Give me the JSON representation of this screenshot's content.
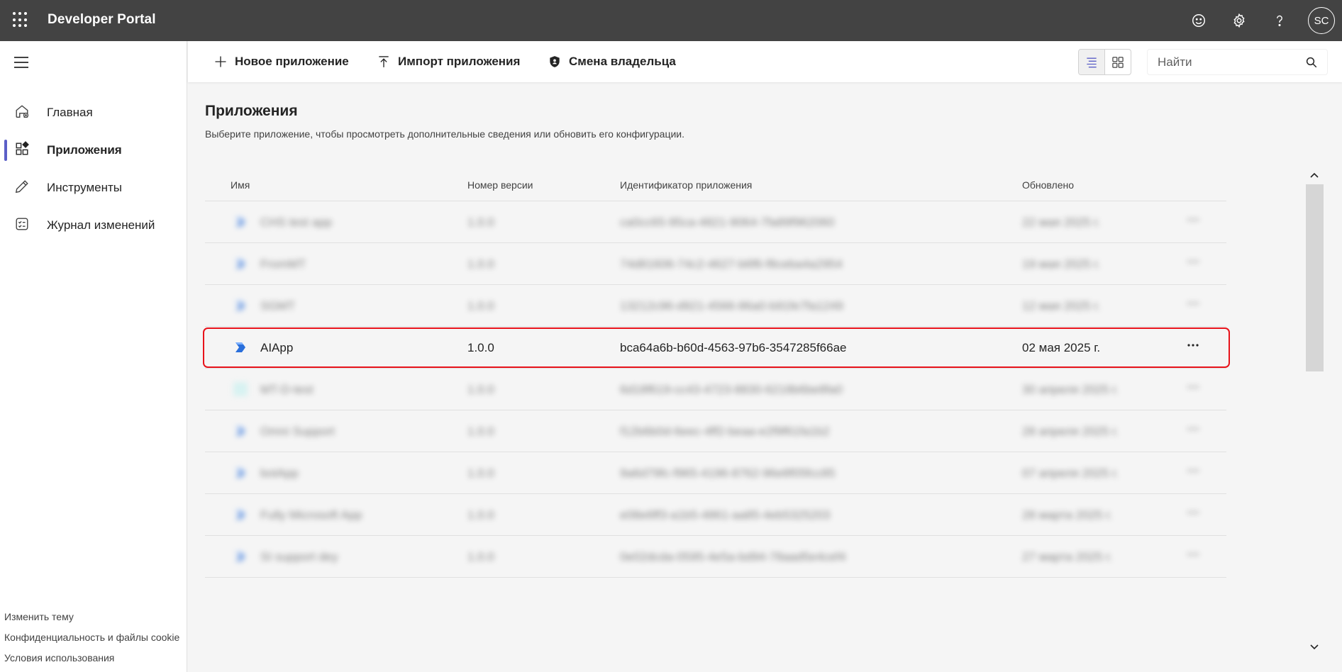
{
  "header": {
    "app_title": "Developer Portal",
    "avatar_initials": "SC",
    "icons": [
      "waffle-icon",
      "feedback-icon",
      "settings-icon",
      "help-icon"
    ]
  },
  "sidebar": {
    "items": [
      {
        "label": "Главная",
        "icon": "home-icon"
      },
      {
        "label": "Приложения",
        "icon": "apps-icon",
        "active": true
      },
      {
        "label": "Инструменты",
        "icon": "tools-icon"
      },
      {
        "label": "Журнал изменений",
        "icon": "changelog-icon"
      }
    ],
    "footer_links": [
      "Изменить тему",
      "Конфиденциальность и файлы cookie",
      "Условия использования"
    ]
  },
  "toolbar": {
    "new_app": "Новое приложение",
    "import_app": "Импорт приложения",
    "change_owner": "Смена владельца",
    "search_placeholder": "Найти"
  },
  "main": {
    "title": "Приложения",
    "description": "Выберите приложение, чтобы просмотреть дополнительные сведения или обновить его конфигурации.",
    "columns": [
      "Имя",
      "Номер версии",
      "Идентификатор приложения",
      "Обновлено"
    ],
    "rows": [
      {
        "name": "CHS test app",
        "version": "1.0.0",
        "id": "ca0cc65-95ca-4821-9064-7fa89f962060",
        "updated": "22 мая 2025 г.",
        "blurred": true
      },
      {
        "name": "FromMT",
        "version": "1.0.0",
        "id": "74d81606-74c2-4627-b6f6-f8ceba4a2954",
        "updated": "19 мая 2025 г.",
        "blurred": true
      },
      {
        "name": "SGMT",
        "version": "1.0.0",
        "id": "13212c96-d921-4566-86a0-b91fe7fa1249",
        "updated": "12 мая 2025 г.",
        "blurred": true
      },
      {
        "name": "AIApp",
        "version": "1.0.0",
        "id": "bca64a6b-b60d-4563-97b6-3547285f66ae",
        "updated": "02 мая 2025 г.",
        "blurred": false
      },
      {
        "name": "MT-D-test",
        "version": "1.0.0",
        "id": "6d18f619-cc43-4723-8830-6218b6be8fa0",
        "updated": "30 апреля 2025 г.",
        "blurred": true
      },
      {
        "name": "Omni Support",
        "version": "1.0.0",
        "id": "f12b6b0d-6eec-4ff2-beaa-e2f9f61fa1b2",
        "updated": "28 апреля 2025 г.",
        "blurred": true
      },
      {
        "name": "botApp",
        "version": "1.0.0",
        "id": "9a6d79fc-f965-4196-8762-96e8f05fcc85",
        "updated": "07 апреля 2025 г.",
        "blurred": true
      },
      {
        "name": "Fully Microsoft App",
        "version": "1.0.0",
        "id": "e08e6ff3-a1b5-4861-aa85-4eb5325203",
        "updated": "28 марта 2025 г.",
        "blurred": true
      },
      {
        "name": "SI support dey",
        "version": "1.0.0",
        "id": "0e02dcda-0595-4e5a-bd94-78aad5e4cef4",
        "updated": "27 марта 2025 г.",
        "blurred": true
      }
    ]
  },
  "colors": {
    "topbar": "#434343",
    "accent": "#5b5fc7",
    "highlight": "#e8131b",
    "app_icon": "#2a6fdb"
  }
}
